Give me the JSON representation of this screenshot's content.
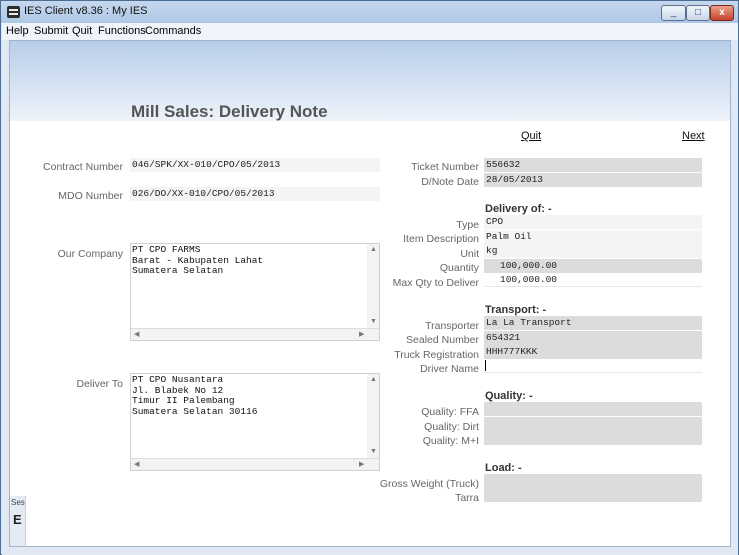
{
  "window": {
    "title": "IES Client v8.36 : My IES",
    "minimize_glyph": "_",
    "maximize_glyph": "□",
    "close_glyph": "x"
  },
  "menu": {
    "items": [
      "Help",
      "Submit",
      "Quit",
      "Functions",
      "Commands"
    ]
  },
  "side": {
    "label": "Ses",
    "glyph": "E"
  },
  "page": {
    "title": "Mill Sales: Delivery Note",
    "quit": "Quit",
    "next": "Next"
  },
  "left": {
    "contract_label": "Contract Number",
    "contract_value": "046/SPK/XX-010/CPO/05/2013",
    "mdo_label": "MDO Number",
    "mdo_value": "026/DO/XX-010/CPO/05/2013",
    "company_label": "Our Company",
    "company_value": "PT CPO FARMS\nBarat - Kabupaten Lahat\nSumatera Selatan",
    "deliver_label": "Deliver To",
    "deliver_value": "PT CPO Nusantara\nJl. Blabek No 12\nTimur II Palembang\nSumatera Selatan 30116"
  },
  "right": {
    "ticket_label": "Ticket Number",
    "ticket_value": "556632",
    "dnote_label": "D/Note Date",
    "dnote_value": "28/05/2013",
    "delivery_heading": "Delivery of: -",
    "type_label": "Type",
    "type_value": "CPO",
    "itemdesc_label": "Item Description",
    "itemdesc_value": "Palm Oil",
    "unit_label": "Unit",
    "unit_value": "kg",
    "quantity_label": "Quantity",
    "quantity_value": "100,000.00",
    "maxqty_label": "Max Qty to Deliver",
    "maxqty_value": "100,000.00",
    "transport_heading": "Transport: -",
    "transporter_label": "Transporter",
    "transporter_value": "La La Transport",
    "sealed_label": "Sealed Number",
    "sealed_value": "654321",
    "truck_label": "Truck Registration",
    "truck_value": "HHH777KKK",
    "driver_label": "Driver Name",
    "driver_value": "",
    "quality_heading": "Quality: -",
    "ffa_label": "Quality: FFA",
    "ffa_value": "",
    "dirt_label": "Quality: Dirt",
    "dirt_value": "",
    "mi_label": "Quality: M+I",
    "mi_value": "",
    "load_heading": "Load: -",
    "gross_label": "Gross Weight (Truck)",
    "gross_value": "",
    "tarra_label": "Tarra",
    "tarra_value": ""
  }
}
